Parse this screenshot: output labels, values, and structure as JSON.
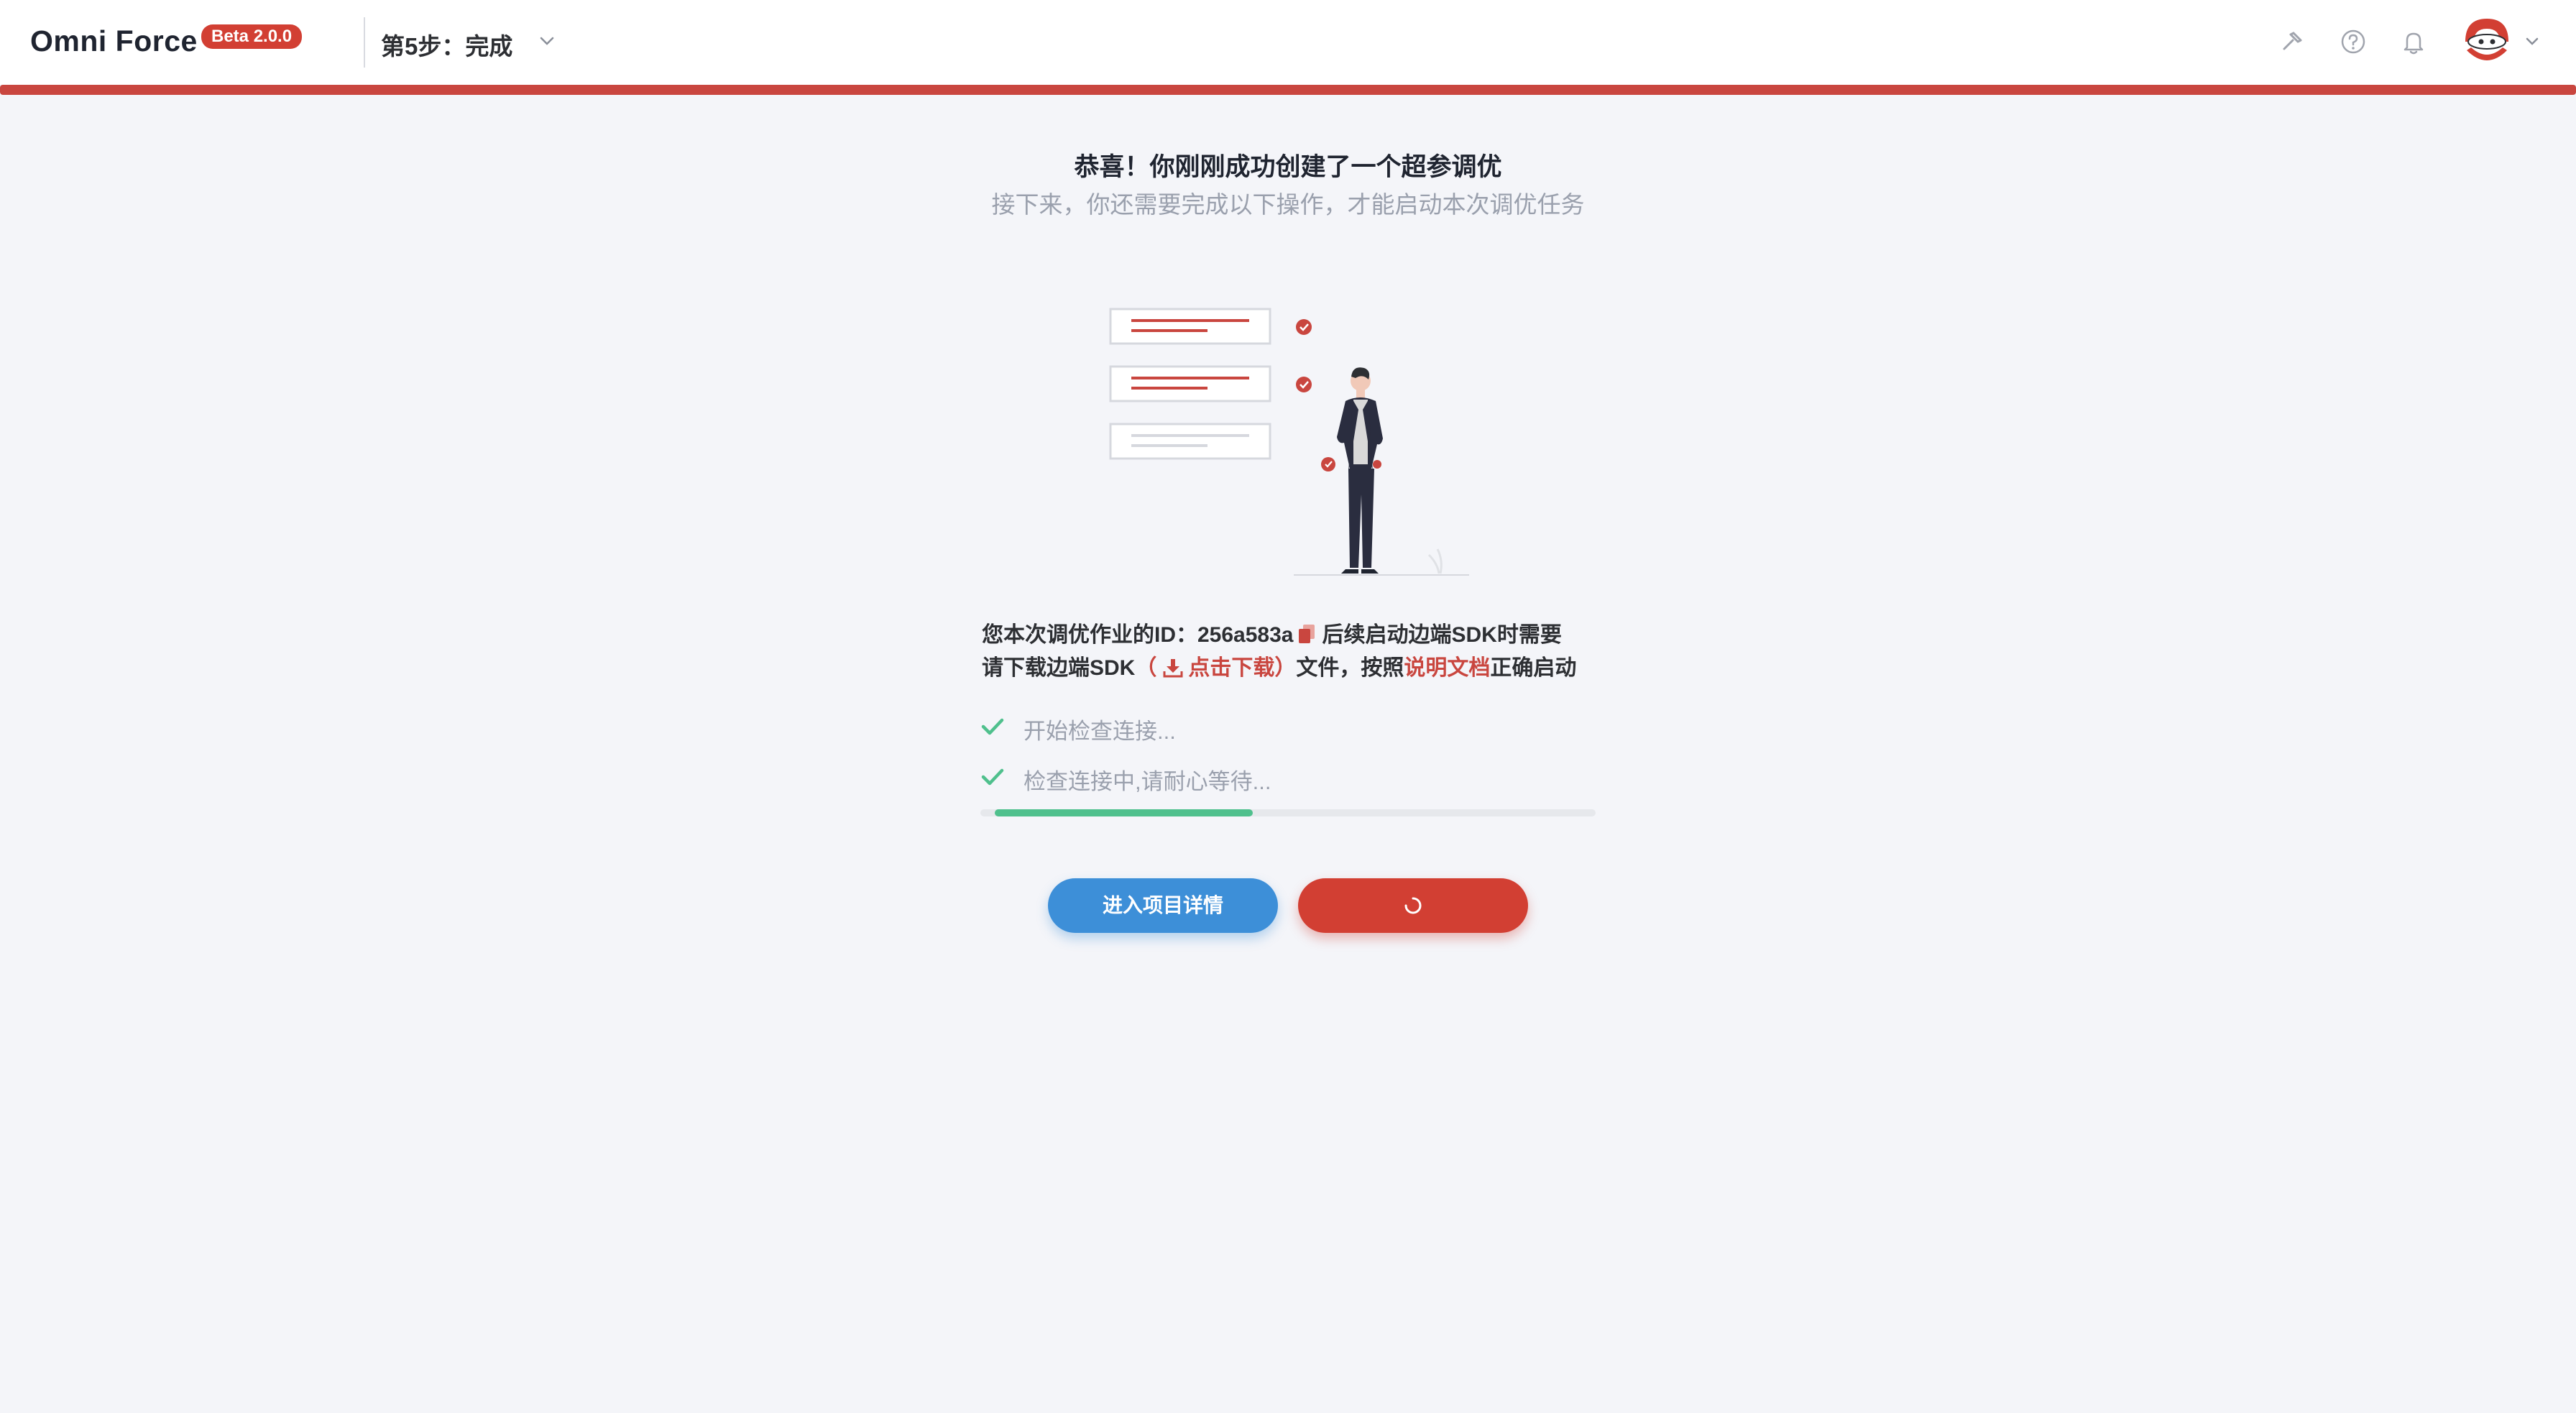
{
  "header": {
    "brand": "Omni Force",
    "badge": "Beta 2.0.0",
    "step": "第5步：完成",
    "icons": [
      "hammer-icon",
      "help-icon",
      "bell-icon",
      "avatar",
      "chevron-down-icon"
    ]
  },
  "main": {
    "title": "恭喜！你刚刚成功创建了一个超参调优",
    "subtitle": "接下来，你还需要完成以下操作，才能启动本次调优任务",
    "id_prefix": "您本次调优作业的ID：",
    "job_id": "256a583a",
    "id_suffix": "后续启动边端SDK时需要",
    "download_prefix": "请下载边端SDK",
    "download_open": "（",
    "download_link": "点击下载",
    "download_close": "）",
    "download_mid": "文件，按照",
    "doc_link": "说明文档",
    "download_suffix": "正确启动",
    "checks": [
      "开始检查连接...",
      "检查连接中,请耐心等待..."
    ],
    "progress_percent": 43,
    "buttons": {
      "project_detail": "进入项目详情"
    }
  },
  "colors": {
    "accent": "#c9463f",
    "primary_blue": "#3d8fd8",
    "success_green": "#4fc08d"
  }
}
